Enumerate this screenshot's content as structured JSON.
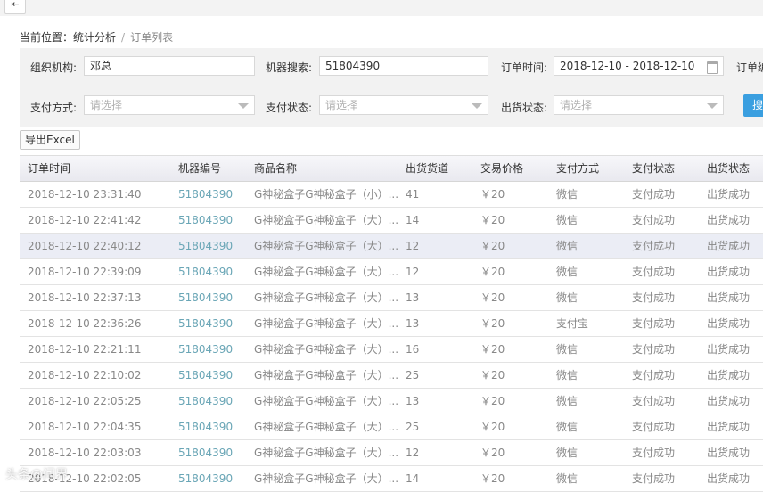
{
  "topbar": {
    "menu_icon": "menu-collapse-icon",
    "menu_glyph": "⇤"
  },
  "breadcrumb": {
    "prefix": "当前位置：",
    "parent": "统计分析",
    "separator": "/",
    "current": "订单列表"
  },
  "filters": {
    "org_label": "组织机构:",
    "org_value": "邓总",
    "machine_label": "机器搜索:",
    "machine_value": "51804390",
    "time_label": "订单时间:",
    "time_value": "2018-12-10 - 2018-12-10",
    "order_label": "订单编",
    "pay_method_label": "支付方式:",
    "pay_method_placeholder": "请选择",
    "pay_status_label": "支付状态:",
    "pay_status_placeholder": "请选择",
    "ship_status_label": "出货状态:",
    "ship_status_placeholder": "请选择",
    "search_label": "搜"
  },
  "toolbar": {
    "export_label": "导出Excel"
  },
  "table": {
    "headers": [
      "订单时间",
      "机器编号",
      "商品名称",
      "出货货道",
      "交易价格",
      "支付方式",
      "支付状态",
      "出货状态"
    ],
    "rows": [
      [
        "2018-12-10 23:31:40",
        "51804390",
        "G神秘盒子G神秘盒子（小）...",
        "41",
        "￥20",
        "微信",
        "支付成功",
        "出货成功"
      ],
      [
        "2018-12-10 22:41:42",
        "51804390",
        "G神秘盒子G神秘盒子（大）...",
        "14",
        "￥20",
        "微信",
        "支付成功",
        "出货成功"
      ],
      [
        "2018-12-10 22:40:12",
        "51804390",
        "G神秘盒子G神秘盒子（大）...",
        "12",
        "￥20",
        "微信",
        "支付成功",
        "出货成功"
      ],
      [
        "2018-12-10 22:39:09",
        "51804390",
        "G神秘盒子G神秘盒子（大）...",
        "12",
        "￥20",
        "微信",
        "支付成功",
        "出货成功"
      ],
      [
        "2018-12-10 22:37:13",
        "51804390",
        "G神秘盒子G神秘盒子（大）...",
        "13",
        "￥20",
        "微信",
        "支付成功",
        "出货成功"
      ],
      [
        "2018-12-10 22:36:26",
        "51804390",
        "G神秘盒子G神秘盒子（大）...",
        "13",
        "￥20",
        "支付宝",
        "支付成功",
        "出货成功"
      ],
      [
        "2018-12-10 22:21:11",
        "51804390",
        "G神秘盒子G神秘盒子（大）...",
        "16",
        "￥20",
        "微信",
        "支付成功",
        "出货成功"
      ],
      [
        "2018-12-10 22:10:02",
        "51804390",
        "G神秘盒子G神秘盒子（大）...",
        "25",
        "￥20",
        "微信",
        "支付成功",
        "出货成功"
      ],
      [
        "2018-12-10 22:05:25",
        "51804390",
        "G神秘盒子G神秘盒子（大）...",
        "13",
        "￥20",
        "微信",
        "支付成功",
        "出货成功"
      ],
      [
        "2018-12-10 22:04:35",
        "51804390",
        "G神秘盒子G神秘盒子（大）...",
        "25",
        "￥20",
        "微信",
        "支付成功",
        "出货成功"
      ],
      [
        "2018-12-10 22:03:03",
        "51804390",
        "G神秘盒子G神秘盒子（大）...",
        "12",
        "￥20",
        "微信",
        "支付成功",
        "出货成功"
      ],
      [
        "2018-12-10 22:02:05",
        "51804390",
        "G神秘盒子G神秘盒子（大）...",
        "14",
        "￥20",
        "微信",
        "支付成功",
        "出货成功"
      ]
    ],
    "highlight_row": 2
  },
  "watermark": "头条@问界"
}
